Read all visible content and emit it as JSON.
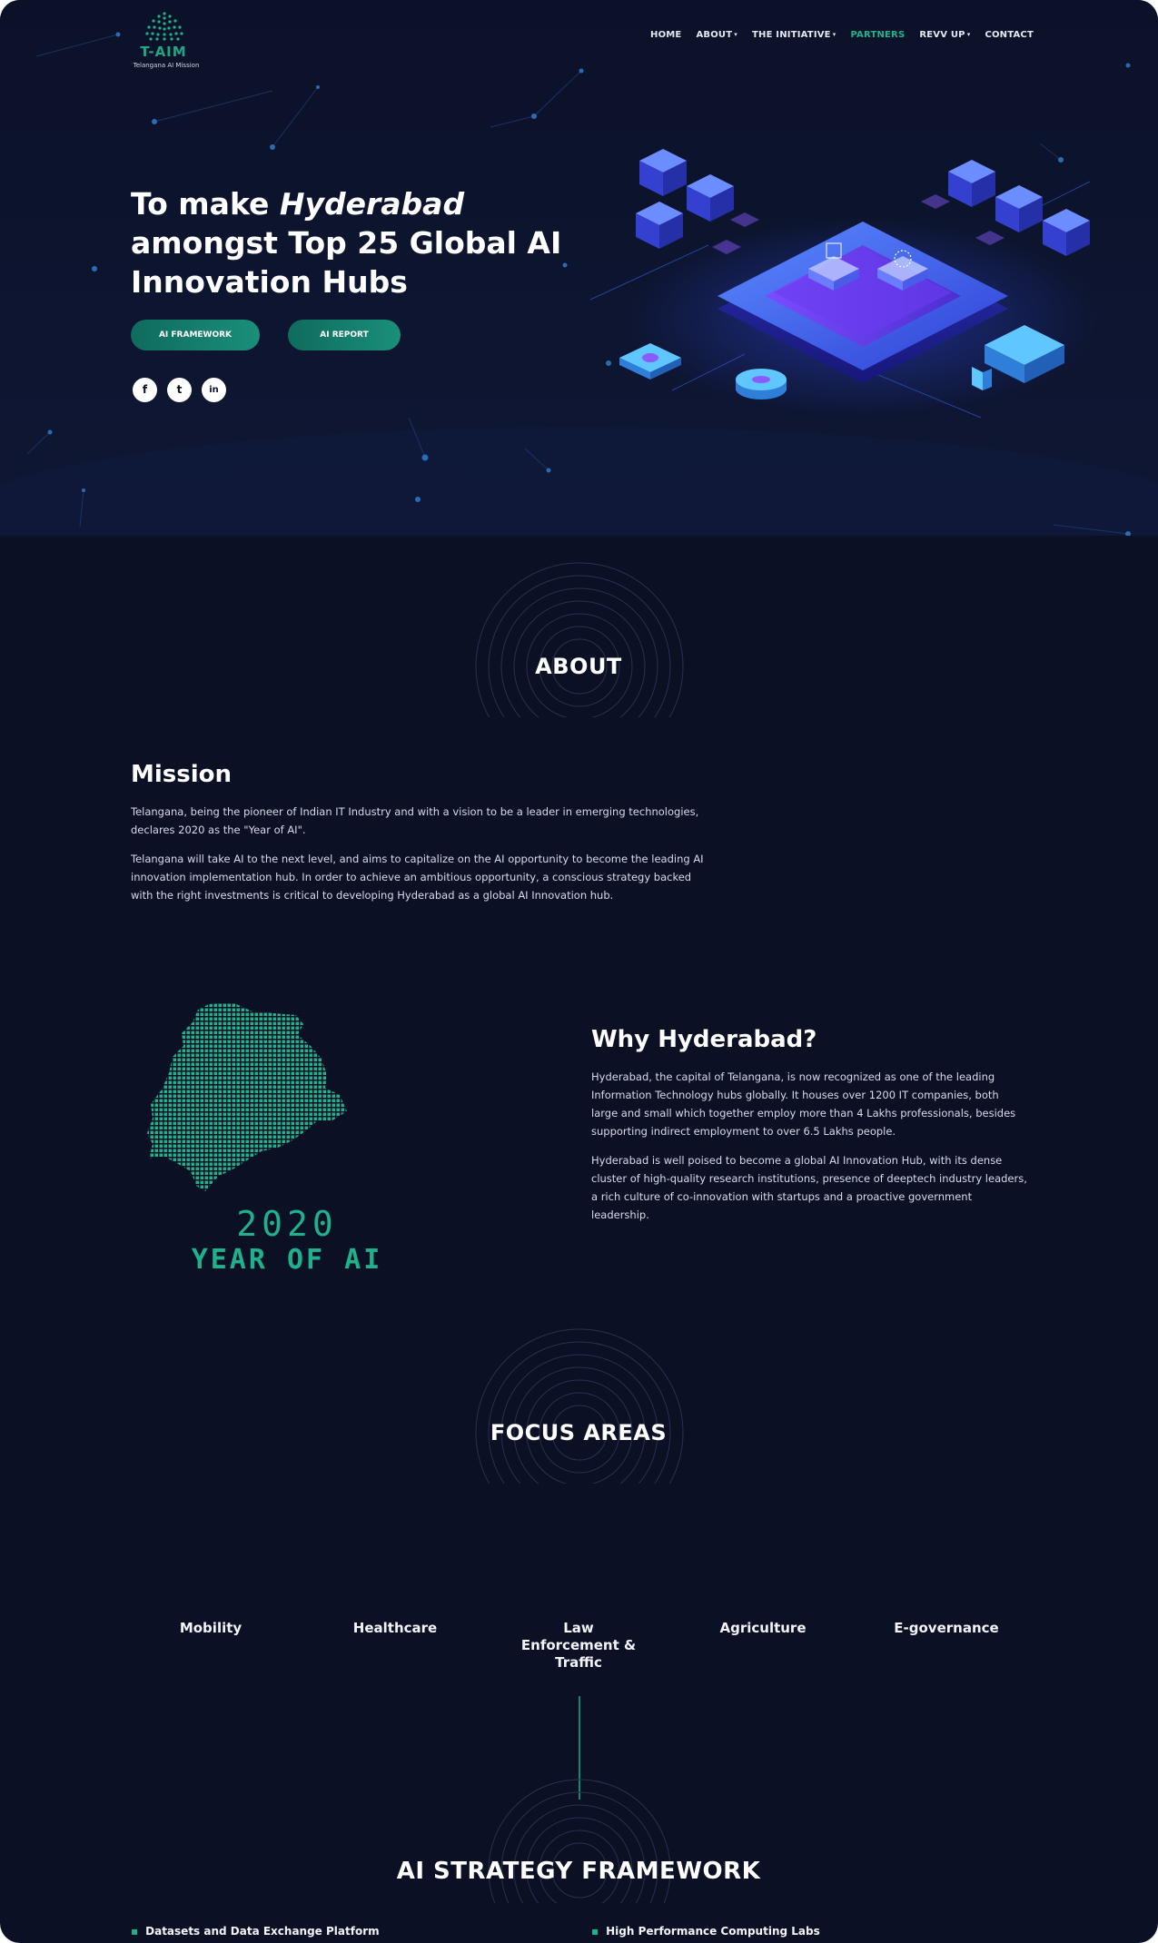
{
  "header": {
    "logo_text": "T-AIM",
    "logo_subtitle": "Telangana AI Mission",
    "nav": [
      {
        "label": "HOME",
        "dropdown": false,
        "active": false
      },
      {
        "label": "ABOUT",
        "dropdown": true,
        "active": false
      },
      {
        "label": "THE INITIATIVE",
        "dropdown": true,
        "active": false
      },
      {
        "label": "PARTNERS",
        "dropdown": false,
        "active": true
      },
      {
        "label": "REVV UP",
        "dropdown": true,
        "active": false
      },
      {
        "label": "CONTACT",
        "dropdown": false,
        "active": false
      }
    ]
  },
  "hero": {
    "title_pre": "To make ",
    "title_italic": "Hyderabad",
    "title_post": " amongst Top 25 Global AI Innovation Hubs",
    "buttons": [
      "AI FRAMEWORK",
      "AI REPORT"
    ],
    "socials": [
      {
        "icon": "facebook-icon",
        "glyph": "f"
      },
      {
        "icon": "twitter-icon",
        "glyph": "t"
      },
      {
        "icon": "linkedin-icon",
        "glyph": "in"
      }
    ]
  },
  "about": {
    "heading": "ABOUT",
    "mission_title": "Mission",
    "mission_p1": "Telangana, being the pioneer of Indian IT Industry and with a vision to be a leader in emerging technologies, declares 2020 as the \"Year of AI\".",
    "mission_p2": "Telangana will take AI to the next level, and aims to capitalize on the AI opportunity to become the leading AI innovation implementation hub. In order to achieve an ambitious opportunity, a conscious strategy backed with the right investments is critical to developing Hyderabad as a global AI Innovation hub.",
    "why_title": "Why Hyderabad?",
    "why_p1": "Hyderabad, the capital of Telangana, is now recognized as one of the leading Information Technology hubs globally. It houses over 1200 IT companies, both large and small which together employ more than 4 Lakhs professionals, besides supporting indirect employment to over 6.5 Lakhs people.",
    "why_p2": "Hyderabad is well poised to become a global AI Innovation Hub, with its dense cluster of high-quality research institutions, presence of deeptech industry leaders, a rich culture of co-innovation with startups and a proactive government leadership.",
    "badge_year": "2020",
    "badge_text": "YEAR OF AI"
  },
  "focus": {
    "heading": "FOCUS AREAS",
    "items": [
      "Mobility",
      "Healthcare",
      "Law Enforcement & Traffic",
      "Agriculture",
      "E-governance"
    ]
  },
  "strategy": {
    "heading": "AI STRATEGY FRAMEWORK",
    "bullets": [
      "Datasets and Data Exchange Platform",
      "High Performance Computing Labs"
    ]
  },
  "colors": {
    "background": "#0c1025",
    "accent": "#1fb08c",
    "button": "#138571"
  }
}
